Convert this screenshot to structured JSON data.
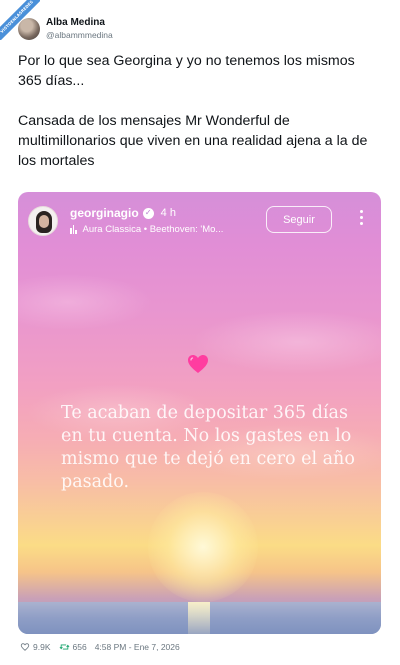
{
  "watermark": {
    "text": "VISTOENLASREDES"
  },
  "author": {
    "display_name": "Alba Medina",
    "handle": "@albammmedina"
  },
  "tweet": {
    "paragraphs": [
      "Por lo que sea Georgina y yo no tenemos los mismos 365 días...",
      "Cansada de los mensajes Mr Wonderful de multimillonarios que viven en una realidad ajena a la de los mortales"
    ]
  },
  "story": {
    "username": "georginagio",
    "time": "4 h",
    "music": "Aura Classica • Beethoven: 'Mo...",
    "follow_label": "Seguir",
    "quote": "Te acaban de depositar 365 días en tu cuenta. No los gastes en lo mismo que te dejó en cero el año pasado."
  },
  "footer": {
    "likes": "9.9K",
    "retweets": "656",
    "timestamp": "4:58 PM - Ene 7, 2026"
  },
  "colors": {
    "verified_badge": "#b97fd0",
    "watermark_band": "#4a90d9",
    "heart": "#ff3da0"
  },
  "icons": [
    "verified-icon",
    "music-bars-icon",
    "more-icon",
    "heart-emoji",
    "like-icon",
    "retweet-icon"
  ]
}
